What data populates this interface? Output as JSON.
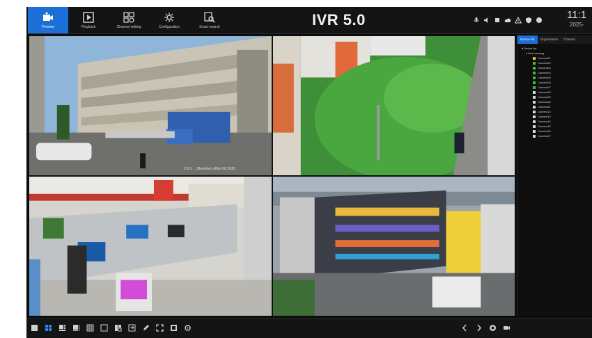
{
  "app": {
    "title": "IVR 5.0"
  },
  "nav": [
    {
      "label": "Preview",
      "icon": "preview-icon",
      "active": true
    },
    {
      "label": "Playback",
      "icon": "playback-icon",
      "active": false
    },
    {
      "label": "Channel setting",
      "icon": "channel-setting-icon",
      "active": false
    },
    {
      "label": "Configuration",
      "icon": "configuration-icon",
      "active": false
    },
    {
      "label": "Smart search",
      "icon": "smart-search-icon",
      "active": false
    }
  ],
  "status_icons": [
    "mic-icon",
    "volume-icon",
    "stop-icon",
    "cloud-icon",
    "warning-icon",
    "shield-icon",
    "user-icon"
  ],
  "clock": {
    "time": "11:1",
    "date": "2025-"
  },
  "channels": [
    {
      "name": "camera-1",
      "osd": "CH 1  ...  Shenzhen office  06 2025"
    },
    {
      "name": "camera-2",
      "osd": ""
    },
    {
      "name": "camera-3",
      "osd": ""
    },
    {
      "name": "camera-4",
      "osd": ""
    }
  ],
  "side_panel": {
    "tabs": [
      "Device list",
      "Organization",
      "Channel"
    ],
    "root": "Device list",
    "group": "Host sensing",
    "devices": [
      "Camera01",
      "Camera02",
      "Camera03",
      "Camera04",
      "Camera05",
      "Camera06",
      "Camera07",
      "Camera08",
      "Camera09",
      "Camera10",
      "Camera11",
      "Camera12",
      "Camera13",
      "Camera14",
      "Camera15",
      "Camera16",
      "Camera17"
    ]
  },
  "toolbar": {
    "left": [
      "layout-1-icon",
      "layout-4-icon",
      "layout-6-icon",
      "layout-8-icon",
      "layout-9-icon",
      "layout-16-icon",
      "layout-custom-icon",
      "sequence-icon",
      "edit-icon",
      "fullscreen-icon",
      "snapshot-icon",
      "settings-icon"
    ],
    "right": [
      "prev-page-icon",
      "next-page-icon",
      "record-icon",
      "camera-icon"
    ]
  },
  "colors": {
    "accent": "#1b6fd6",
    "bg": "#0b0b0b",
    "bar": "#141414"
  }
}
